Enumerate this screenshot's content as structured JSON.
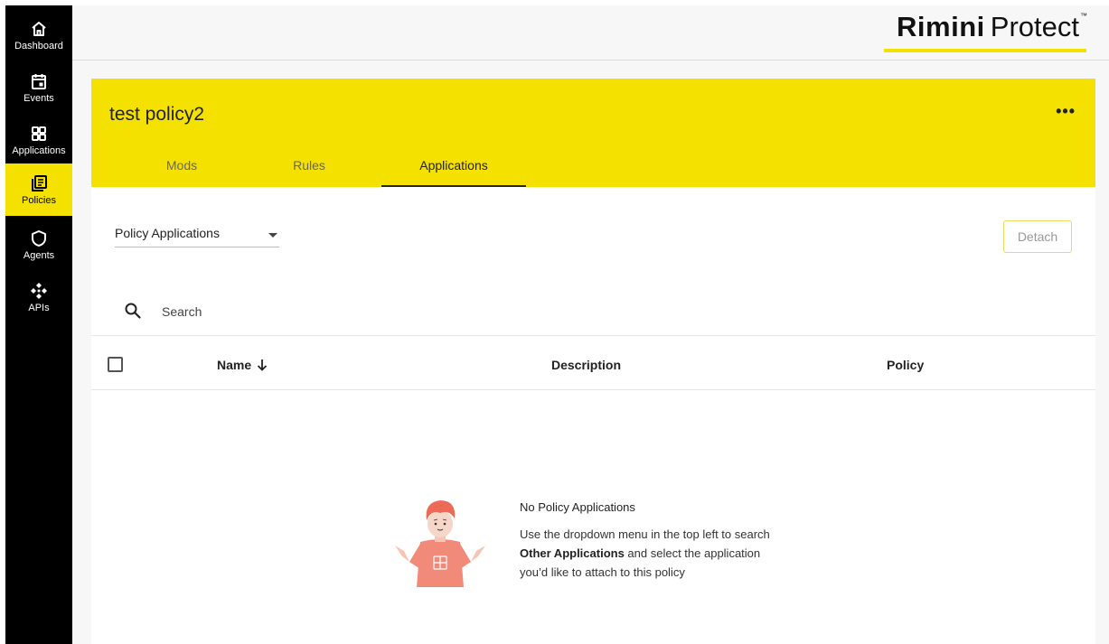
{
  "sidebar": {
    "items": [
      {
        "label": "Dashboard",
        "icon": "home-icon",
        "active": false
      },
      {
        "label": "Events",
        "icon": "calendar-icon",
        "active": false
      },
      {
        "label": "Applications",
        "icon": "grid-icon",
        "active": false
      },
      {
        "label": "Policies",
        "icon": "document-list-icon",
        "active": true
      },
      {
        "label": "Agents",
        "icon": "shield-icon",
        "active": false
      },
      {
        "label": "APIs",
        "icon": "api-diamond-icon",
        "active": false
      }
    ]
  },
  "header": {
    "brand_bold": "Rimini",
    "brand_light": "Protect",
    "brand_tm": "™"
  },
  "policy": {
    "title": "test policy2",
    "more_label": "•••",
    "tabs": [
      {
        "label": "Mods",
        "active": false
      },
      {
        "label": "Rules",
        "active": false
      },
      {
        "label": "Applications",
        "active": true
      }
    ]
  },
  "toolbar": {
    "view_select_value": "Policy Applications",
    "detach_label": "Detach"
  },
  "search": {
    "placeholder": "Search",
    "value": ""
  },
  "table": {
    "columns": [
      {
        "label": "Name",
        "sort": "descending"
      },
      {
        "label": "Description"
      },
      {
        "label": "Policy"
      }
    ]
  },
  "empty_state": {
    "title": "No Policy Applications",
    "line1": "Use the dropdown menu in the top left to search",
    "line2_bold": "Other Applications",
    "line2_rest": " and select the application",
    "line3": "you’d like to attach to this policy"
  },
  "colors": {
    "accent": "#f5e100",
    "sidebar_bg": "#000000",
    "illustration": "#f28a7a"
  }
}
